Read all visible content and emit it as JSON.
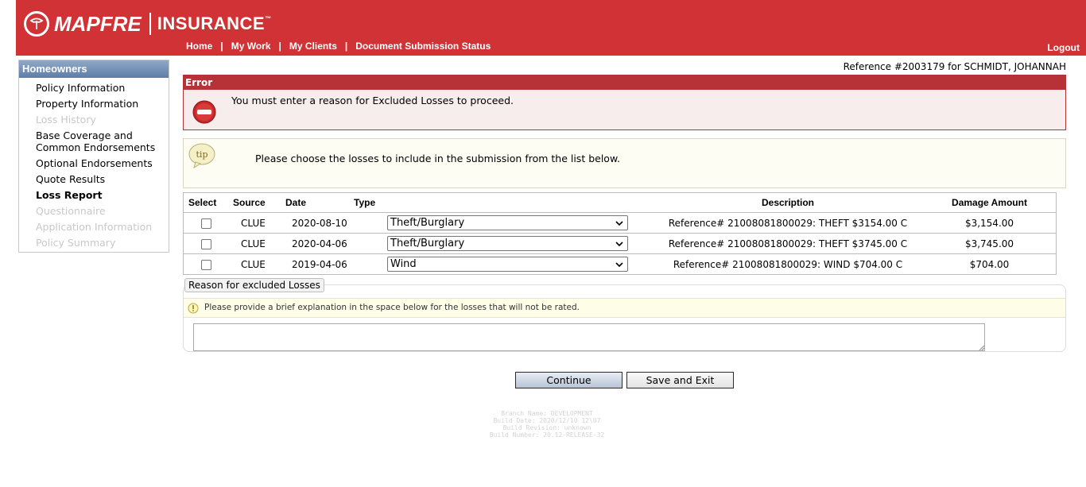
{
  "header": {
    "brand": "MAPFRE",
    "brand2": "INSURANCE",
    "trademark": "™",
    "nav": [
      "Home",
      "My Work",
      "My Clients",
      "Document Submission Status"
    ],
    "nav_separator": "|",
    "logout": "Logout",
    "background_color": "#d03235"
  },
  "sidebar": {
    "title": "Homeowners",
    "items": [
      {
        "label": "Policy Information",
        "state": "enabled"
      },
      {
        "label": "Property Information",
        "state": "enabled"
      },
      {
        "label": "Loss History",
        "state": "disabled"
      },
      {
        "label": "Base Coverage and Common Endorsements",
        "state": "enabled"
      },
      {
        "label": "Optional Endorsements",
        "state": "enabled"
      },
      {
        "label": "Quote Results",
        "state": "enabled"
      },
      {
        "label": "Loss Report",
        "state": "active"
      },
      {
        "label": "Questionnaire",
        "state": "disabled"
      },
      {
        "label": "Application Information",
        "state": "disabled"
      },
      {
        "label": "Policy Summary",
        "state": "disabled"
      }
    ]
  },
  "main": {
    "reference": "Reference #2003179 for SCHMIDT, JOHANNAH",
    "error": {
      "title": "Error",
      "icon": "stop-icon",
      "message": "You must enter a reason for Excluded Losses to proceed."
    },
    "tip": {
      "icon_label": "tip",
      "message": "Please choose the losses to include in the submission from the list below."
    },
    "table": {
      "headers": {
        "select": "Select",
        "source": "Source",
        "date": "Date",
        "type": "Type",
        "description": "Description",
        "damage": "Damage Amount"
      },
      "rows": [
        {
          "checked": false,
          "source": "CLUE",
          "date": "2020-08-10",
          "type": "Theft/Burglary",
          "description": "Reference# 21008081800029: THEFT $3154.00 C",
          "damage": "$3,154.00"
        },
        {
          "checked": false,
          "source": "CLUE",
          "date": "2020-04-06",
          "type": "Theft/Burglary",
          "description": "Reference# 21008081800029: THEFT $3745.00 C",
          "damage": "$3,745.00"
        },
        {
          "checked": false,
          "source": "CLUE",
          "date": "2019-04-06",
          "type": "Wind",
          "description": "Reference# 21008081800029: WIND $704.00 C",
          "damage": "$704.00"
        }
      ]
    },
    "reason": {
      "legend": "Reason for excluded Losses",
      "hint": "Please provide a brief explanation in the space below for the losses that will not be rated.",
      "value": ""
    },
    "buttons": {
      "continue": "Continue",
      "save_exit": "Save and Exit"
    }
  },
  "footer": {
    "branch": "Branch Name: DEVELOPMENT",
    "build_date": "Build Date: 2020/12/10 12\\07",
    "revision": "Build Revision: unknown",
    "number": "Build Number: 20.12-RELEASE-32"
  }
}
